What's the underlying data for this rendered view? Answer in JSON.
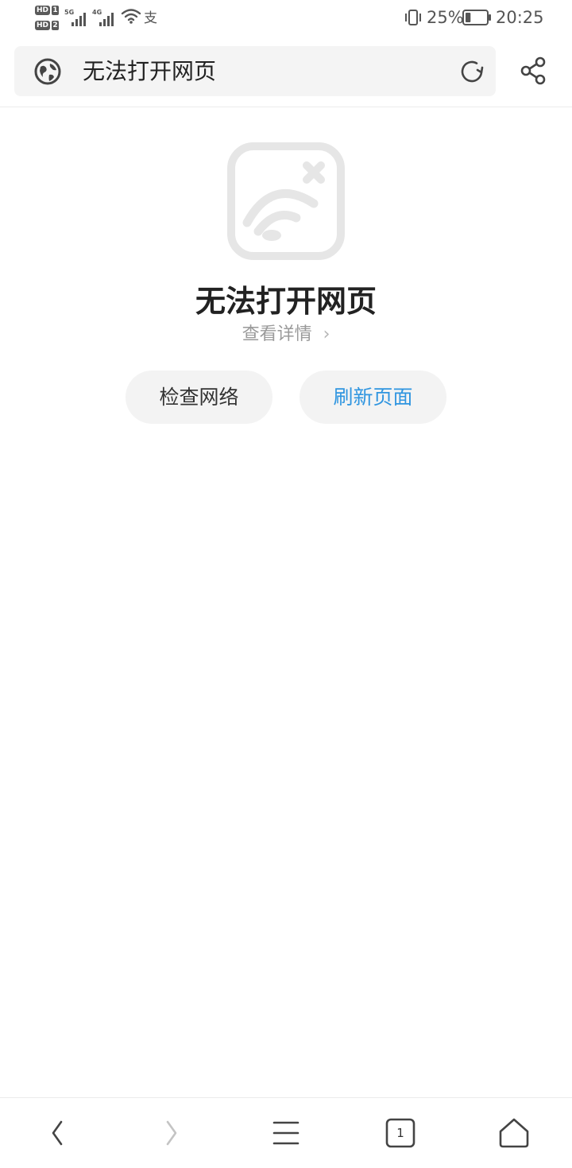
{
  "status_bar": {
    "sim1_tag": "HD",
    "sim1_num": "1",
    "sim2_tag": "HD",
    "sim2_num": "2",
    "network1_label": "5G",
    "network2_label": "4G",
    "alipay_glyph": "支",
    "battery_percent": "25%",
    "battery_level": 0.25,
    "time": "20:25"
  },
  "address_bar": {
    "site_icon": "globe-icon",
    "text": "无法打开网页",
    "refresh_icon": "refresh-icon",
    "share_icon": "share-icon"
  },
  "error": {
    "icon": "no-wifi-icon",
    "title": "无法打开网页",
    "details_link": "查看详情",
    "details_chevron": "›"
  },
  "buttons": {
    "check_network": "检查网络",
    "refresh_page": "刷新页面"
  },
  "toolbar": {
    "back_icon": "back-arrow-icon",
    "forward_icon": "forward-arrow-icon",
    "menu_icon": "menu-icon",
    "tabs_count": "1",
    "home_icon": "home-icon"
  },
  "colors": {
    "accent": "#2f95e0",
    "pill_bg": "#f3f3f3",
    "address_bg": "#f4f4f4",
    "icon_gray": "#555555"
  }
}
